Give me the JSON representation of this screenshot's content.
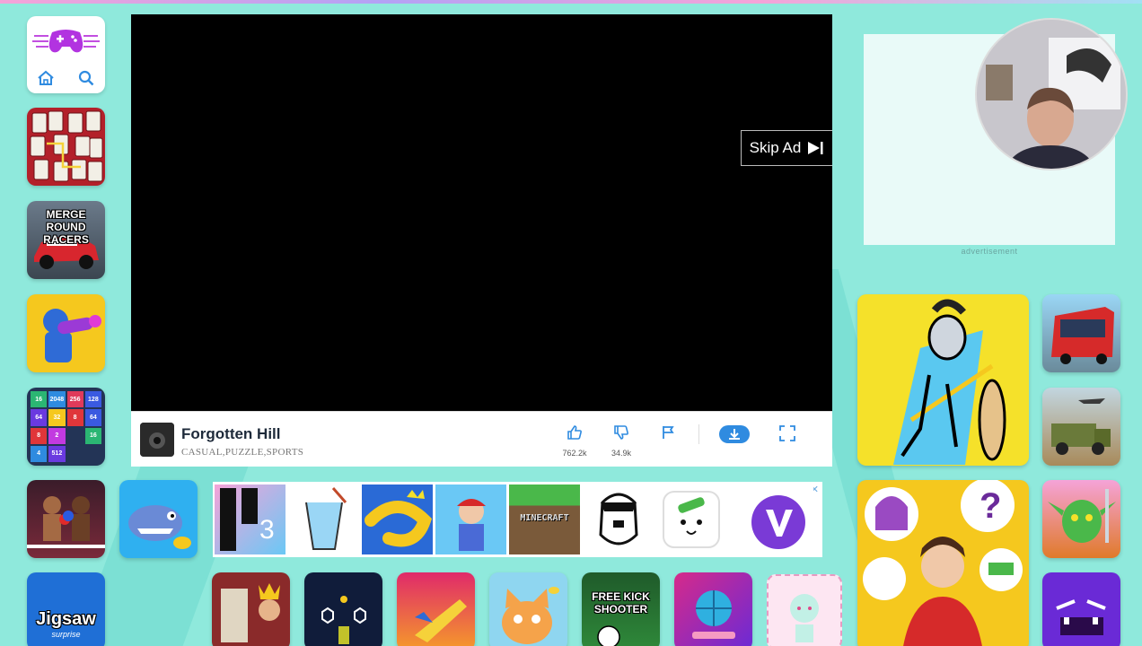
{
  "player": {
    "skip_ad_label": "Skip Ad",
    "game_title": "Forgotten Hill",
    "game_categories": "CASUAL,PUZZLE,SPORTS",
    "like_count": "762.2k",
    "dislike_count": "34.9k"
  },
  "sidebar_ad": {
    "label": "advertisement"
  },
  "tiles": {
    "merge_round_racers": "MERGE ROUND RACERS",
    "jigsaw": "Jigsaw",
    "jigsaw_sub": "surprise",
    "free_kick": "FREE KICK SHOOTER",
    "minecraft": "MINECRAFT"
  },
  "grid_numbers": [
    "16",
    "2048",
    "256",
    "128",
    "64",
    "32",
    "8",
    "64",
    "8",
    "2",
    "",
    "16",
    "4",
    "512",
    "",
    ""
  ],
  "icons": {
    "home": "home-icon",
    "search": "search-icon",
    "like": "thumbs-up-icon",
    "dislike": "thumbs-down-icon",
    "report": "flag-icon",
    "download": "download-icon",
    "fullscreen": "fullscreen-icon"
  },
  "colors": {
    "background": "#8fe9dc",
    "accent_blue": "#2f8be0",
    "logo_purple": "#b233e0"
  }
}
